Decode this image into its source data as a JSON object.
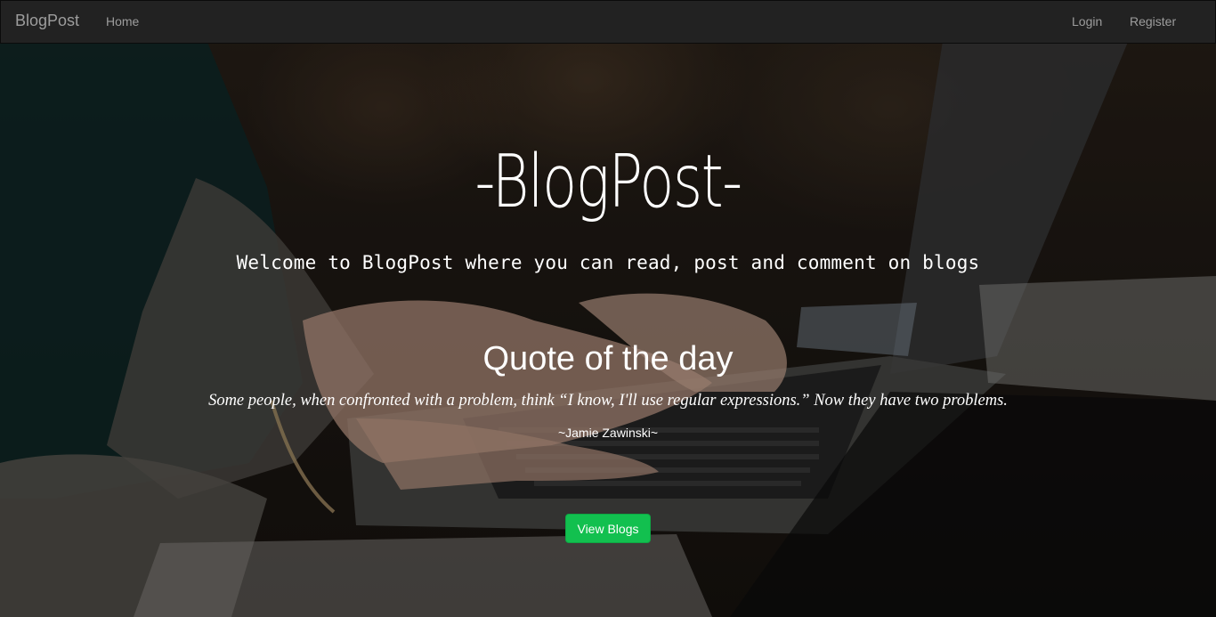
{
  "navbar": {
    "brand": "BlogPost",
    "links": {
      "home": "Home",
      "login": "Login",
      "register": "Register"
    }
  },
  "hero": {
    "title": "-BlogPost-",
    "subtitle": "Welcome to BlogPost where you can read, post and comment on blogs",
    "quote_heading": "Quote of the day",
    "quote_text": "Some people, when confronted with a problem, think “I know, I'll use regular expressions.” Now they have two problems.",
    "quote_author": "~Jamie Zawinski~",
    "cta_label": "View Blogs"
  },
  "colors": {
    "navbar_bg": "#222222",
    "nav_text": "#9d9d9d",
    "cta_green": "#12c04f",
    "hero_text": "#ffffff"
  }
}
